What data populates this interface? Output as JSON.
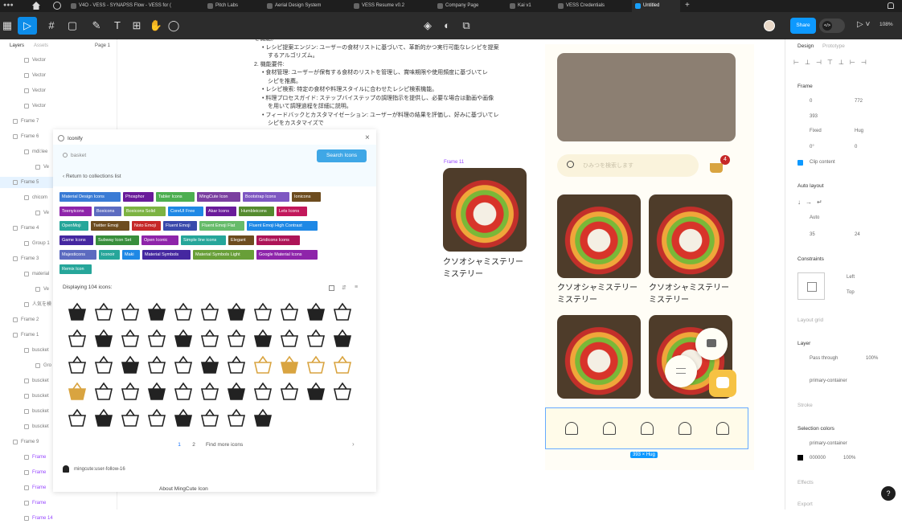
{
  "tabs": [
    {
      "label": "V4O - VESS - SYNAPSS Flow - VESS for ("
    },
    {
      "label": "Pitch Labs"
    },
    {
      "label": "Aerial Design System"
    },
    {
      "label": "VESS Resume v0.2"
    },
    {
      "label": "Company Page"
    },
    {
      "label": "Kai v1"
    },
    {
      "label": "VESS Credentials"
    },
    {
      "label": "Untitled"
    }
  ],
  "tab_plus": "+",
  "toolbar": {
    "share": "Share",
    "zoom": "108%",
    "code_icon": "</>"
  },
  "left": {
    "tab_layers": "Layers",
    "tab_assets": "Assets",
    "page": "Page 1",
    "rows": [
      "Vector",
      "Vector",
      "Vector",
      "Vector",
      "Frame 7",
      "Frame 6",
      "mdi:lee",
      "Ve",
      "Frame 5",
      "chicom",
      "Ve",
      "Frame 4",
      "Group 1",
      "Frame 3",
      "material",
      "Ve",
      "人気を検",
      "Frame 2",
      "Frame 1",
      "buscket",
      "Gro",
      "buscket",
      "buscket",
      "buscket",
      "buscket",
      "Frame 9",
      "Frame",
      "Frame",
      "Frame",
      "Frame",
      "Frame 14"
    ]
  },
  "doc_text": [
    "を機能。",
    "• レシピ提案エンジン: ユーザーの食材リストに基づいて、革新的かつ実行可能なレシピを提案",
    "　するアルゴリズム。",
    "2. 機能要件:",
    "• 食材管理: ユーザーが保有する食材のリストを管理し、賞味期限や使用頻度に基づいてレ",
    "　シピを推薦。",
    "• レシピ検索: 特定の食材や料理スタイルに合わせたレシピ検索機能。",
    "• 料理プロセスガイド: ステップバイステップの調理指示を提供し、必要な場合は動画や画像",
    "　を用いて調理過程を詳細に説明。",
    "• フィードバックとカスタマイゼーション: ユーザーが料理の結果を評価し、好みに基づいてレ",
    "　シピをカスタマイズで"
  ],
  "iconify": {
    "title": "Iconify",
    "search_value": "basket",
    "search_button": "Search Icons",
    "back": "‹ Return to collections list",
    "collections": [
      {
        "name": "Material Design Icons",
        "color": "#3a7bd5"
      },
      {
        "name": "Phosphor",
        "color": "#6a1b9a"
      },
      {
        "name": "Tabler Icons",
        "color": "#4caf50"
      },
      {
        "name": "MingCute Icon",
        "color": "#7b3fa0"
      },
      {
        "name": "Bootstrap Icons",
        "color": "#7e57c2"
      },
      {
        "name": "Ionicons",
        "color": "#6d4c1f"
      },
      {
        "name": "Teenyicons",
        "color": "#8e24aa"
      },
      {
        "name": "Boxicons",
        "color": "#5c6bc0"
      },
      {
        "name": "Boxicons Solid",
        "color": "#7cb342"
      },
      {
        "name": "CoreUI Free",
        "color": "#1e88e5"
      },
      {
        "name": "Akar Icons",
        "color": "#6a1b9a"
      },
      {
        "name": "Humbleicons",
        "color": "#558b2f"
      },
      {
        "name": "Lets Icons",
        "color": "#c2185b"
      },
      {
        "name": "OpenMoji",
        "color": "#26a69a"
      },
      {
        "name": "Twitter Emoji",
        "color": "#6d4c1f"
      },
      {
        "name": "Noto Emoji",
        "color": "#c62828"
      },
      {
        "name": "Fluent Emoji",
        "color": "#3949ab"
      },
      {
        "name": "Fluent Emoji Flat",
        "color": "#66bb6a"
      },
      {
        "name": "Fluent Emoji High Contrast",
        "color": "#1e88e5"
      },
      {
        "name": "Game Icons",
        "color": "#4527a0"
      },
      {
        "name": "Subway Icon Set",
        "color": "#388e3c"
      },
      {
        "name": "Open Iconic",
        "color": "#8e24aa"
      },
      {
        "name": "Simple line icons",
        "color": "#26a69a"
      },
      {
        "name": "Elegant",
        "color": "#6d4c1f"
      },
      {
        "name": "Gridicons Icons",
        "color": "#ad1457"
      },
      {
        "name": "Majesticons",
        "color": "#5c6bc0"
      },
      {
        "name": "Iconoir",
        "color": "#26a69a"
      },
      {
        "name": "Maki",
        "color": "#1e88e5"
      },
      {
        "name": "Material Symbols",
        "color": "#4527a0"
      },
      {
        "name": "Material Symbols Light",
        "color": "#689f38"
      },
      {
        "name": "Google Material Icons",
        "color": "#8e24aa"
      },
      {
        "name": "Remix Icon",
        "color": "#26a69a"
      }
    ],
    "count_label": "Displaying 104 icons:",
    "pages": [
      "1",
      "2"
    ],
    "find_more": "Find more icons",
    "next": "›",
    "selected_icon": "mingcute:user-follow-16",
    "about": "About MingCute Icon"
  },
  "phone": {
    "search_placeholder": "ひみつを検索します",
    "badge": "4",
    "frame_label": "Frame 11",
    "card_title_1": "クソオシャミステリー",
    "card_title_2": "ミステリー",
    "nav_size_label": "393 × Hug"
  },
  "right": {
    "tab_design": "Design",
    "tab_prototype": "Prototype",
    "frame": "Frame",
    "x": "0",
    "y": "393",
    "w": "772",
    "h": "Hug",
    "wlabel": "Fixed",
    "rot": "0°",
    "rad": "0",
    "clip": "Clip content",
    "autolayout": "Auto layout",
    "auto": "Auto",
    "gap": "35",
    "pad": "24",
    "constraints": "Constraints",
    "c_left": "Left",
    "c_top": "Top",
    "layout_grid": "Layout grid",
    "layer": "Layer",
    "blend": "Pass through",
    "opacity": "100%",
    "fill_name": "primary-container",
    "stroke": "Stroke",
    "selection_colors": "Selection colors",
    "sel1": "primary-container",
    "sel2": "000000",
    "sel2op": "100%",
    "effects": "Effects",
    "export": "Export"
  },
  "help": "?"
}
